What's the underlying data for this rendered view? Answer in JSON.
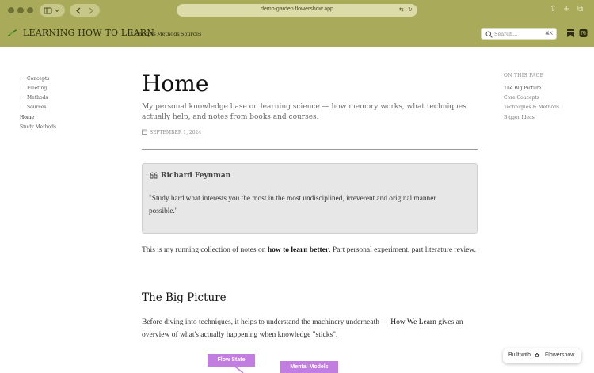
{
  "browser": {
    "url": "demo-garden.flowershow.app"
  },
  "site": {
    "title": "LEARNING HOW TO LEARN",
    "nav": [
      "Concepts",
      "Methods",
      "Sources"
    ],
    "search_placeholder": "Search...",
    "search_shortcut": "⌘K",
    "accent_color": "#a9ab5b"
  },
  "sidebar": {
    "items": [
      {
        "label": "Concepts",
        "folder": true
      },
      {
        "label": "Fleeting",
        "folder": true
      },
      {
        "label": "Methods",
        "folder": true
      },
      {
        "label": "Sources",
        "folder": true
      },
      {
        "label": "Home",
        "folder": false
      },
      {
        "label": "Study Methods",
        "folder": false
      }
    ]
  },
  "toc": {
    "title": "ON THIS PAGE",
    "items": [
      "The Big Picture",
      "Core Concepts",
      "Techniques & Methods",
      "Bigger Ideas"
    ]
  },
  "page": {
    "title": "Home",
    "subtitle": "My personal knowledge base on learning science — how memory works, what techniques actually help, and notes from books and courses.",
    "date": "SEPTEMBER 1, 2024",
    "quote": {
      "author": "Richard Feynman",
      "text": "\"Study hard what interests you the most in the most undisciplined, irreverent and original manner possible.\""
    },
    "intro": {
      "before": "This is my running collection of notes on ",
      "bold": "how to learn better",
      "after": ". Part personal experiment, part literature review."
    },
    "section_heading": "The Big Picture",
    "section_para": {
      "before": "Before diving into techniques, it helps to understand the machinery underneath — ",
      "link": "How We Learn",
      "after": " gives an overview of what's actually happening when knowledge \"sticks\"."
    },
    "diagram_nodes": [
      "Flow State",
      "Mental Models"
    ],
    "diagram_color": "#c17ee0"
  },
  "badge": {
    "prefix": "Built with",
    "name": "Flowershow"
  }
}
